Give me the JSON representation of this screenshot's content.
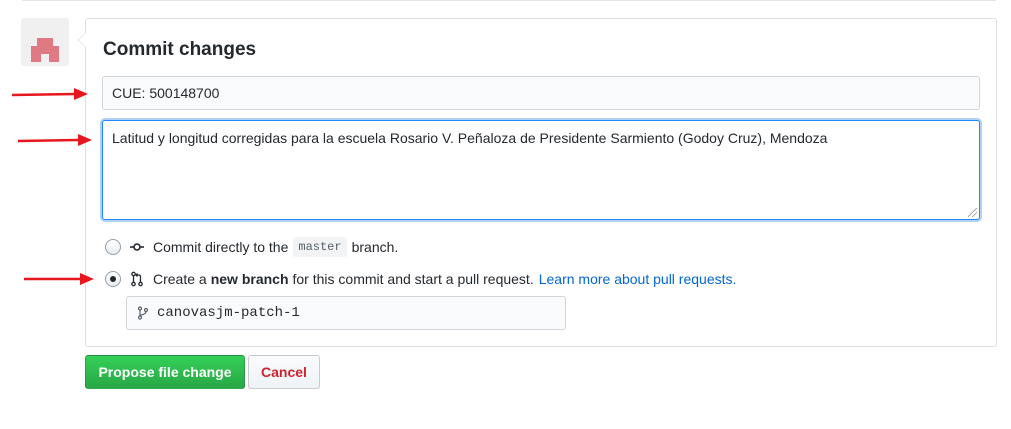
{
  "form": {
    "title": "Commit changes",
    "summary_value": "CUE: 500148700",
    "description_value": "Latitud y longitud corregidas para la escuela Rosario V. Peñaloza de Presidente Sarmiento (Godoy Cruz), Mendoza"
  },
  "options": {
    "direct": {
      "text_before": "Commit directly to the",
      "branch": "master",
      "text_after": "branch.",
      "checked": false
    },
    "new_branch": {
      "text_before": "Create a",
      "bold": "new branch",
      "text_after": "for this commit and start a pull request.",
      "link": "Learn more about pull requests.",
      "checked": true
    }
  },
  "branch_name": "canovasjm-patch-1",
  "buttons": {
    "propose": "Propose file change",
    "cancel": "Cancel"
  },
  "colors": {
    "annotation_arrow": "#e8161d",
    "primary_button": "#28a745",
    "link": "#0366d6",
    "cancel_text": "#cb2431"
  },
  "icons": {
    "avatar": "identicon-avatar",
    "commit": "git-commit-icon",
    "pull_request": "git-pull-request-icon",
    "branch": "git-branch-icon"
  }
}
